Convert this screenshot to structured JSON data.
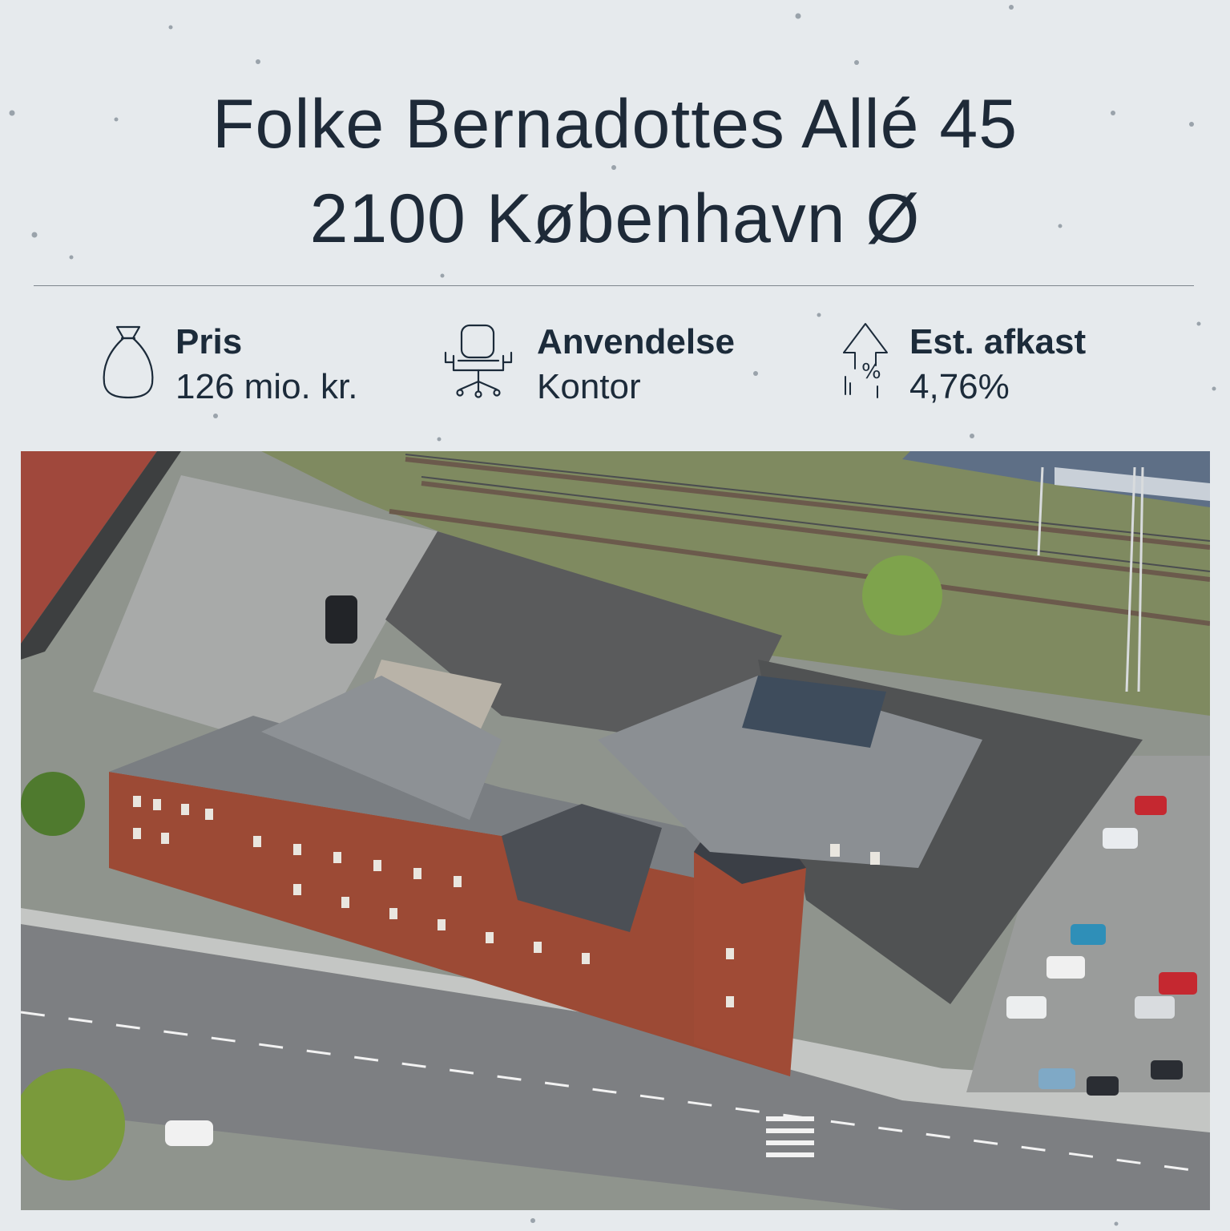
{
  "address": {
    "line1": "Folke Bernadottes Allé 45",
    "line2": "2100 København Ø"
  },
  "stats": [
    {
      "icon": "money-bag-icon",
      "label": "Pris",
      "value": "126 mio. kr."
    },
    {
      "icon": "office-chair-icon",
      "label": "Anvendelse",
      "value": "Kontor"
    },
    {
      "icon": "yield-arrow-percent-icon",
      "label": "Est. afkast",
      "value": "4,76%"
    }
  ],
  "photo": {
    "subject": "aerial-building-photo"
  },
  "colors": {
    "background": "#e6eaed",
    "text": "#1c2b3a",
    "divider": "#7d858d",
    "brick": "#9c4a35",
    "roof": "#55595e"
  }
}
